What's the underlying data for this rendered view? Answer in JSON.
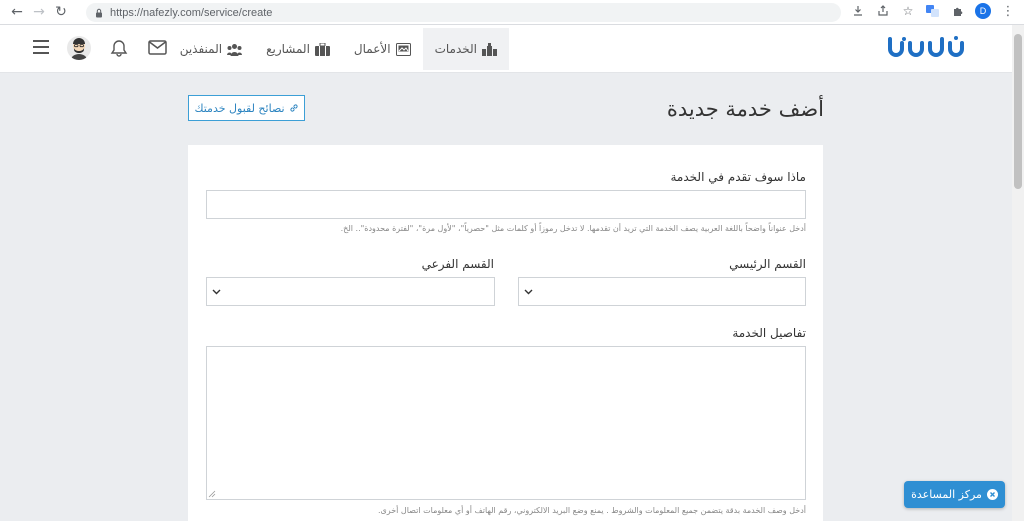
{
  "browser": {
    "url": "https://nafezly.com/service/create",
    "profile_initial": "D"
  },
  "header": {
    "logo_alt": "nafezly",
    "menu": [
      {
        "label": "الخدمات",
        "icon": "services-icon",
        "active": true
      },
      {
        "label": "الأعمال",
        "icon": "portfolio-icon",
        "active": false
      },
      {
        "label": "المشاريع",
        "icon": "projects-icon",
        "active": false
      },
      {
        "label": "المنفذين",
        "icon": "freelancers-icon",
        "active": false
      }
    ]
  },
  "page": {
    "title": "أضف خدمة جديدة",
    "tips_button": "نصائح لقبول خدمتك"
  },
  "form": {
    "service_title": {
      "label": "ماذا سوف تقدم في الخدمة",
      "value": "",
      "help": "أدخل عنواناً واضحاً باللغة العربية يصف الخدمة التي تريد أن تقدمها. لا تدخل رموزاً أو كلمات مثل \"حصرياً\"، \"لأول مرة\"، \"لفترة محدودة\".. الخ."
    },
    "main_category": {
      "label": "القسم الرئيسي",
      "value": ""
    },
    "sub_category": {
      "label": "القسم الفرعي",
      "value": ""
    },
    "details": {
      "label": "تفاصيل الخدمة",
      "value": "",
      "help": "أدخل وصف الخدمة بدقة يتضمن جميع المعلومات والشروط . يمنع وضع البريد الالكتروني، رقم الهاتف أو أي معلومات اتصال أخرى."
    }
  },
  "help_center": {
    "label": "مركز المساعدة"
  },
  "colors": {
    "accent": "#2f8fd3",
    "logo": "#1f6fc4"
  }
}
